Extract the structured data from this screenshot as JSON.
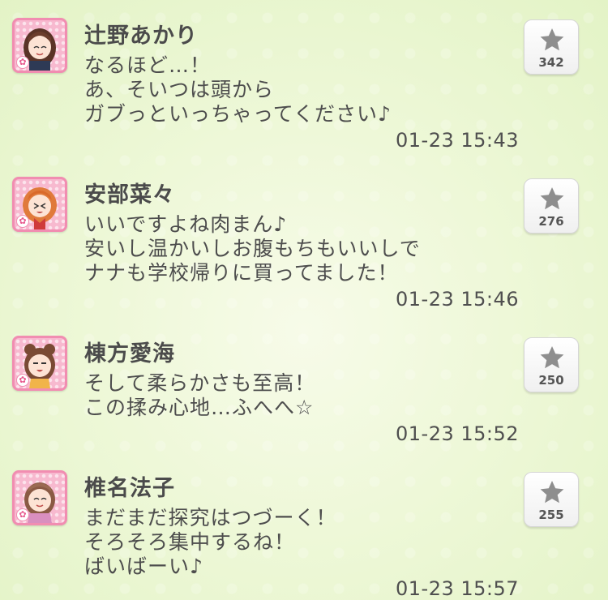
{
  "posts": [
    {
      "name": "辻野あかり",
      "lines": [
        "なるほど…！",
        "あ、そいつは頭から",
        "ガブっといっちゃってください♪"
      ],
      "timestamp": "01-23 15:43",
      "likes": "342",
      "avatar_icon": "character-avatar-icon"
    },
    {
      "name": "安部菜々",
      "lines": [
        "いいですよね肉まん♪",
        "安いし温かいしお腹もちもいいしで",
        "ナナも学校帰りに買ってました！"
      ],
      "timestamp": "01-23 15:46",
      "likes": "276",
      "avatar_icon": "character-avatar-icon"
    },
    {
      "name": "棟方愛海",
      "lines": [
        "そして柔らかさも至高！",
        "この揉み心地…ふへへ☆"
      ],
      "timestamp": "01-23 15:52",
      "likes": "250",
      "avatar_icon": "character-avatar-icon"
    },
    {
      "name": "椎名法子",
      "lines": [
        "まだまだ探究はつづーく！",
        "そろそろ集中するね！",
        "ばいばーい♪"
      ],
      "timestamp": "01-23 15:57",
      "likes": "255",
      "avatar_icon": "character-avatar-icon"
    }
  ],
  "colors": {
    "avatar_frame": "#f18db1",
    "star": "#8e8e8e",
    "text": "#4d4d4d"
  }
}
